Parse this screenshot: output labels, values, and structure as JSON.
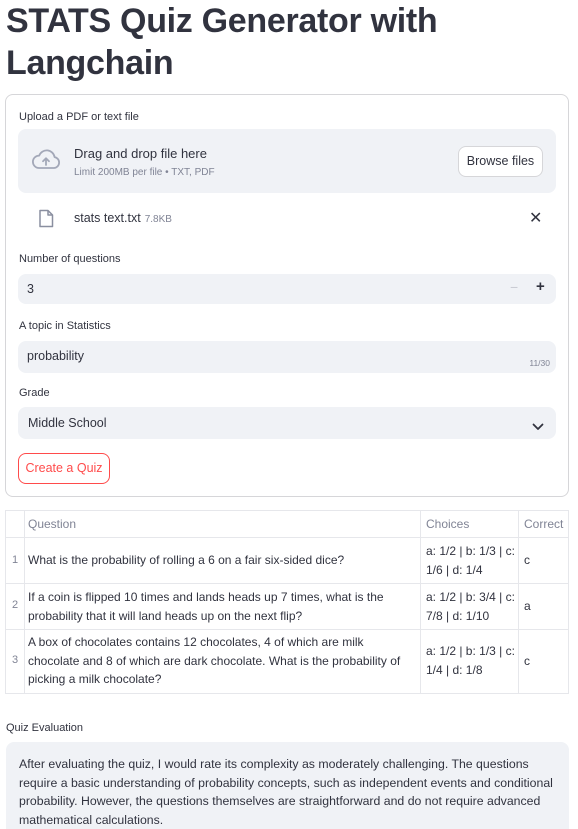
{
  "page": {
    "title": "STATS Quiz Generator with Langchain"
  },
  "upload": {
    "label": "Upload a PDF or text file",
    "drop_title": "Drag and drop file here",
    "drop_limit": "Limit 200MB per file • TXT, PDF",
    "browse_label": "Browse files",
    "file_name": "stats text.txt",
    "file_size": "7.8KB",
    "remove_glyph": "✕"
  },
  "num_questions": {
    "label": "Number of questions",
    "value": "3",
    "minus": "−",
    "plus": "+"
  },
  "topic": {
    "label": "A topic in Statistics",
    "value": "probability",
    "counter": "11/30"
  },
  "grade": {
    "label": "Grade",
    "value": "Middle School"
  },
  "create_button": "Create a Quiz",
  "quiz_table": {
    "headers": [
      "Question",
      "Choices",
      "Correct"
    ],
    "rows": [
      {
        "index": "1",
        "question": "What is the probability of rolling a 6 on a fair six-sided dice?",
        "choices": "a: 1/2 | b: 1/3 | c: 1/6 | d: 1/4",
        "correct": "c"
      },
      {
        "index": "2",
        "question": "If a coin is flipped 10 times and lands heads up 7 times, what is the probability that it will land heads up on the next flip?",
        "choices": "a: 1/2 | b: 3/4 | c: 7/8 | d: 1/10",
        "correct": "a"
      },
      {
        "index": "3",
        "question": "A box of chocolates contains 12 chocolates, 4 of which are milk chocolate and 8 of which are dark chocolate. What is the probability of picking a milk chocolate?",
        "choices": "a: 1/2 | b: 1/3 | c: 1/4 | d: 1/8",
        "correct": "c"
      }
    ]
  },
  "evaluation": {
    "label": "Quiz Evaluation",
    "text": "After evaluating the quiz, I would rate its complexity as moderately challenging. The questions require a basic understanding of probability concepts, such as independent events and conditional probability. However, the questions themselves are straightforward and do not require advanced mathematical calculations."
  },
  "colors": {
    "accent": "#ff4b4b",
    "input_bg": "#f0f2f6",
    "text": "#31333f",
    "muted": "#808495",
    "border": "#d6d6d9"
  },
  "icons": {
    "cloud": "cloud-upload-icon",
    "file": "file-icon",
    "close": "close-icon",
    "chevron": "chevron-down-icon"
  }
}
